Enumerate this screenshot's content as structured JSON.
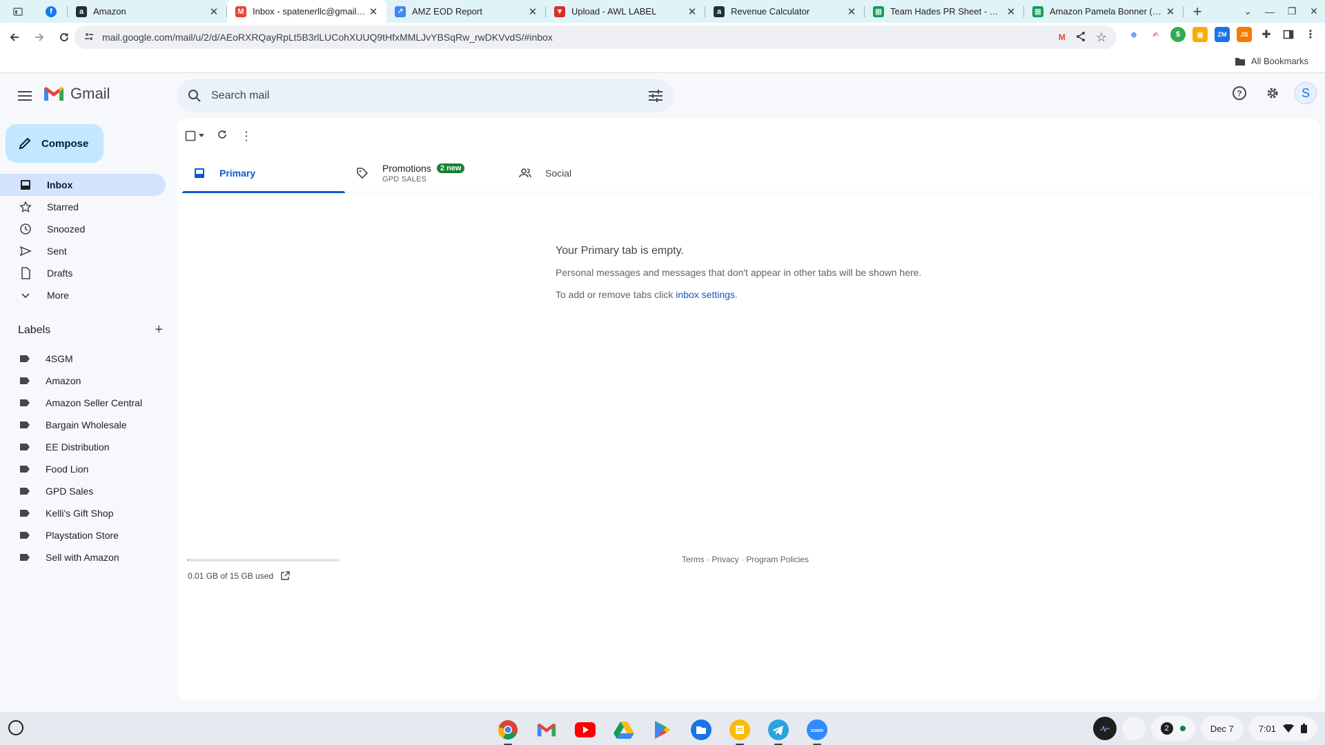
{
  "browser": {
    "tabs": [
      {
        "title": "Amazon",
        "favicon": "amazon-icon",
        "color": "#232f3e",
        "active": false
      },
      {
        "title": "Inbox - spatenerllc@gmail.com",
        "favicon": "gmail-icon",
        "color": "#ea4335",
        "active": true
      },
      {
        "title": "AMZ EOD Report",
        "favicon": "report-icon",
        "color": "#4285f4",
        "active": false
      },
      {
        "title": "Upload - AWL LABEL",
        "favicon": "upload-icon",
        "color": "#d93025",
        "active": false
      },
      {
        "title": "Revenue Calculator",
        "favicon": "amazon-icon",
        "color": "#232f3e",
        "active": false
      },
      {
        "title": "Team Hades PR Sheet - Google",
        "favicon": "sheets-icon",
        "color": "#0f9d58",
        "active": false
      },
      {
        "title": "Amazon Pamela Bonner (Dr B",
        "favicon": "sheets-icon",
        "color": "#0f9d58",
        "active": false
      }
    ],
    "url": "mail.google.com/mail/u/2/d/AEoRXRQayRpLt5B3rlLUCohXUUQ9tHfxMMLJvYBSqRw_rwDKVvdS/#inbox",
    "all_bookmarks": "All Bookmarks"
  },
  "gmail": {
    "logo_text": "Gmail",
    "search_placeholder": "Search mail",
    "avatar_letter": "S",
    "compose_label": "Compose",
    "nav": [
      {
        "label": "Inbox",
        "icon": "inbox-icon",
        "active": true
      },
      {
        "label": "Starred",
        "icon": "star-icon",
        "active": false
      },
      {
        "label": "Snoozed",
        "icon": "clock-icon",
        "active": false
      },
      {
        "label": "Sent",
        "icon": "send-icon",
        "active": false
      },
      {
        "label": "Drafts",
        "icon": "draft-icon",
        "active": false
      },
      {
        "label": "More",
        "icon": "chevron-down-icon",
        "active": false
      }
    ],
    "labels_title": "Labels",
    "labels": [
      "4SGM",
      "Amazon",
      "Amazon Seller Central",
      "Bargain Wholesale",
      "EE Distribution",
      "Food Lion",
      "GPD Sales",
      "Kelli's Gift Shop",
      "Playstation Store",
      "Sell with Amazon"
    ],
    "tabs": {
      "primary": "Primary",
      "promotions": "Promotions",
      "promotions_badge": "2 new",
      "promotions_sub": "GPD SALES",
      "social": "Social"
    },
    "empty": {
      "title": "Your Primary tab is empty.",
      "line1": "Personal messages and messages that don't appear in other tabs will be shown here.",
      "line2_prefix": "To add or remove tabs click ",
      "line2_link": "inbox settings",
      "line2_suffix": "."
    },
    "storage": {
      "text": "0.01 GB of 15 GB used",
      "used_fraction": 0.001
    },
    "footer": {
      "terms": "Terms",
      "privacy": "Privacy",
      "policies": "Program Policies",
      "sep": " · "
    }
  },
  "shelf": {
    "apps": [
      "chrome-icon",
      "gmail-icon",
      "youtube-icon",
      "drive-icon",
      "play-store-icon",
      "files-icon",
      "keep-icon",
      "telegram-icon",
      "zoom-icon"
    ],
    "notification_count": "2",
    "date": "Dec 7",
    "time": "7:01"
  }
}
